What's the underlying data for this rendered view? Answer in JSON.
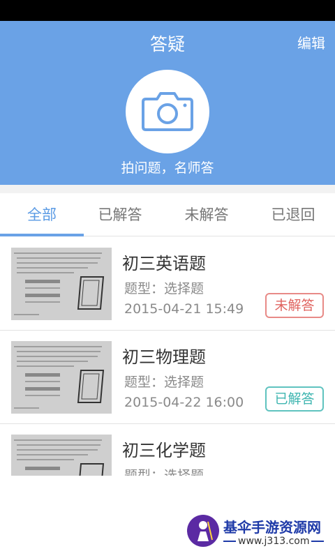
{
  "header": {
    "title": "答疑",
    "edit_label": "编辑",
    "subtitle": "拍问题，名师答",
    "camera_icon": "camera-icon"
  },
  "tabs": [
    {
      "label": "全部",
      "active": true
    },
    {
      "label": "已解答",
      "active": false
    },
    {
      "label": "未解答",
      "active": false
    },
    {
      "label": "已退回",
      "active": false
    }
  ],
  "questions": [
    {
      "title": "初三英语题",
      "type": "题型：选择题",
      "date": "2015-04-21  15:49",
      "status": "未解答"
    },
    {
      "title": "初三物理题",
      "type": "题型：选择题",
      "date": "2015-04-22 16:00",
      "status": "已解答"
    },
    {
      "title": "初三化学题",
      "type": "题型：选择题",
      "date": "",
      "status": ""
    }
  ],
  "watermark": {
    "text": "基伞手游资源网",
    "url": "www.j313.com"
  },
  "colors": {
    "header_bg": "#6aa2e6",
    "tab_active": "#5a9ae4",
    "unanswered": "#e0635f",
    "answered": "#3eb5b0"
  }
}
